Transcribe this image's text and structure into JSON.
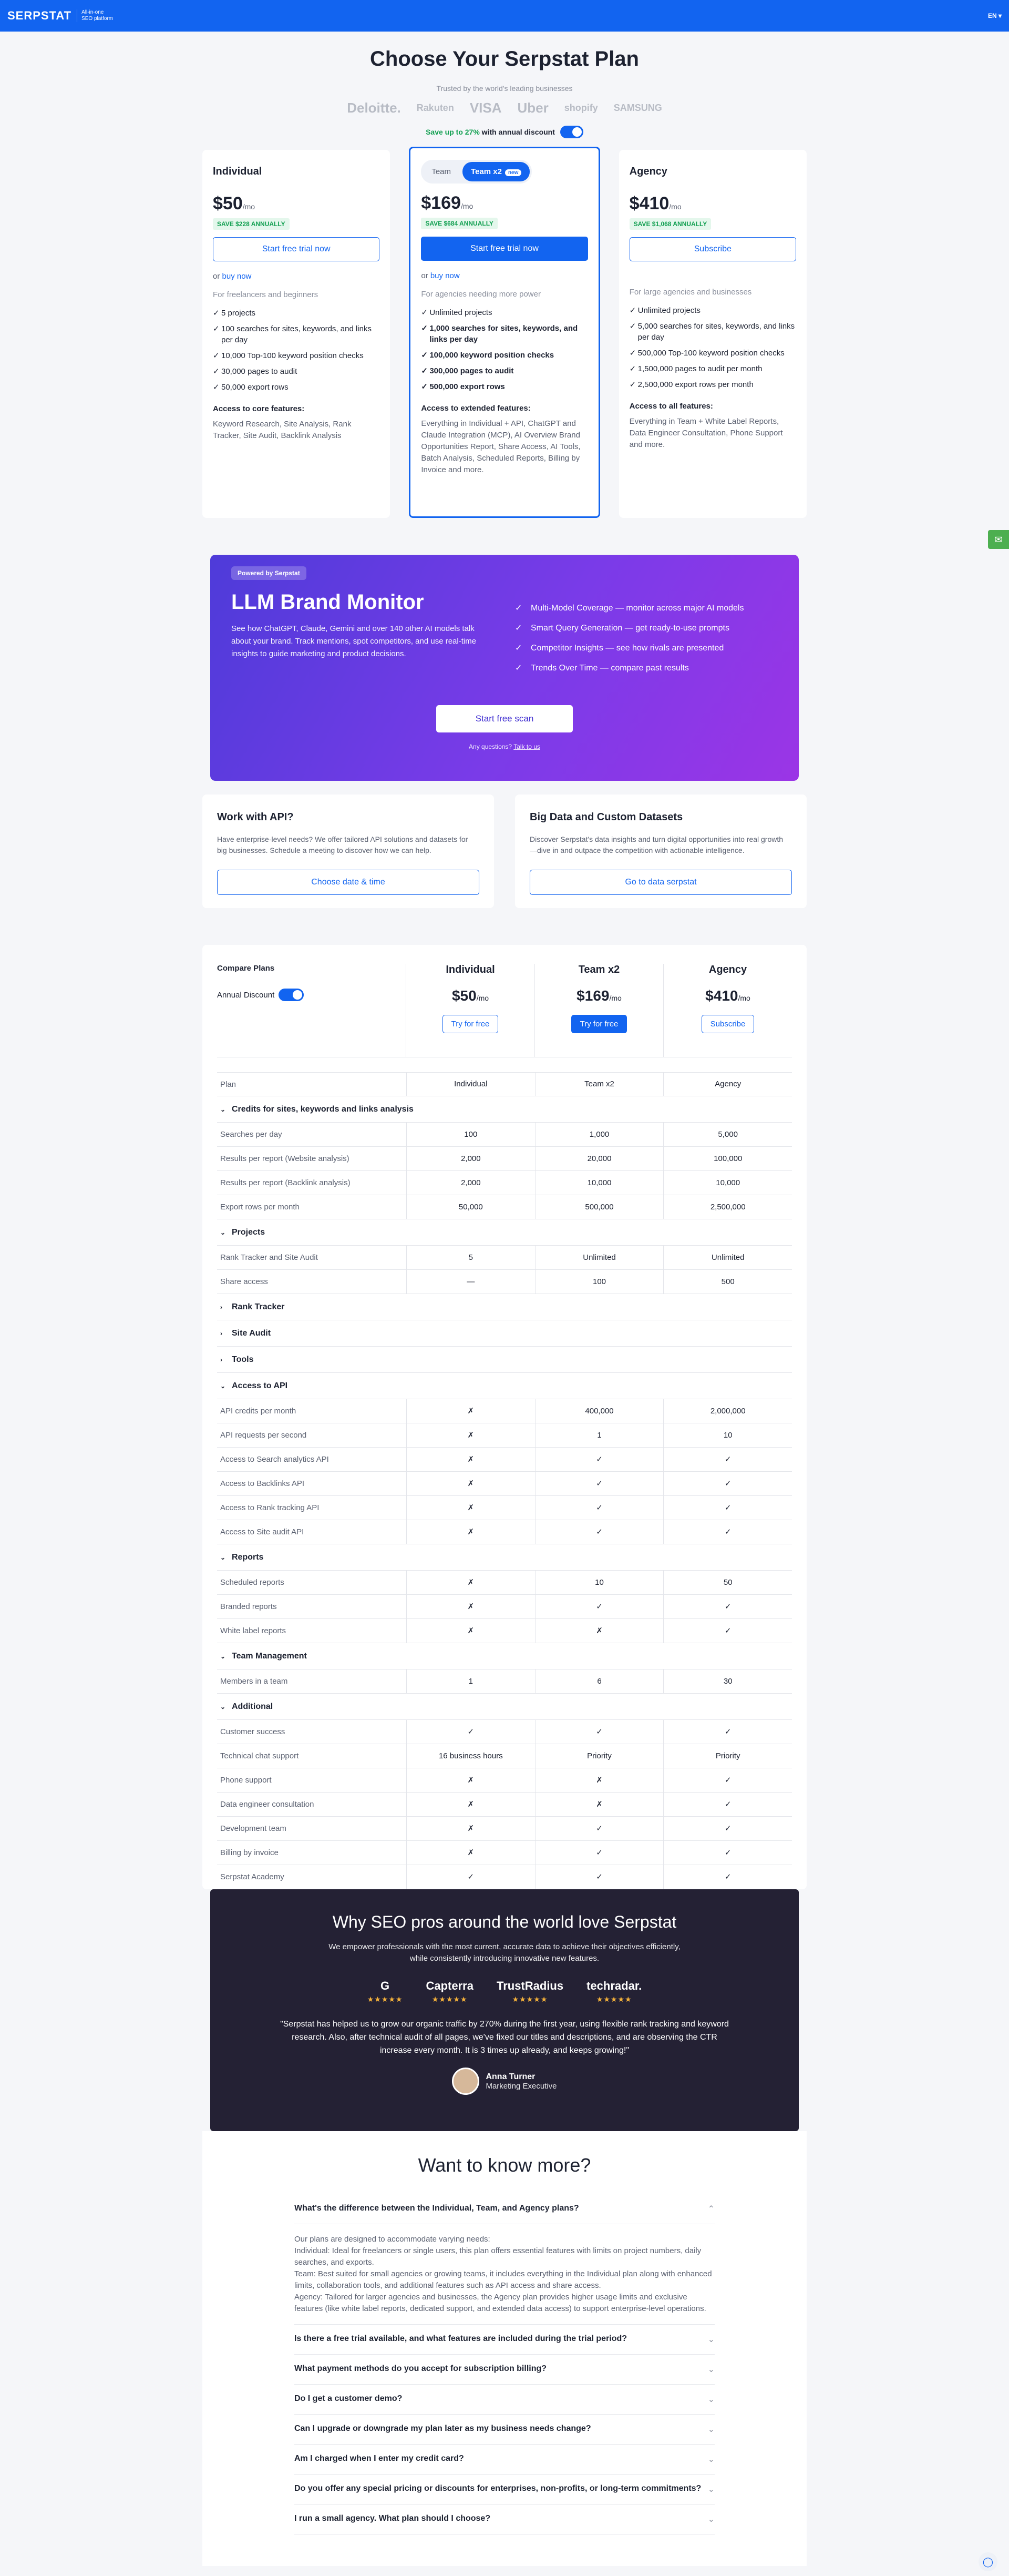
{
  "header": {
    "logo": "SERPSTAT",
    "tagline1": "All-in-one",
    "tagline2": "SEO platform",
    "lang": "EN ▾"
  },
  "hero": {
    "title": "Choose Your Serpstat Plan",
    "trusted": "Trusted by the world's leading businesses",
    "brands": [
      "Deloitte.",
      "Rakuten",
      "VISA",
      "Uber",
      "shopify",
      "SAMSUNG"
    ],
    "discount_prefix": "Save up to 27%",
    "discount_suffix": "with annual discount"
  },
  "plans": [
    {
      "name": "Individual",
      "price": "$50",
      "per": "/mo",
      "save": "SAVE $228 ANNUALLY",
      "cta": "Start free trial now",
      "or": "or",
      "buy": "buy now",
      "for": "For freelancers and beginners",
      "features": [
        "5 projects",
        "100 searches for sites, keywords, and links per day",
        "10,000 Top-100 keyword position checks",
        "30,000 pages to audit",
        "50,000 export rows"
      ],
      "access_title": "Access to core features:",
      "access": "Keyword Research, Site Analysis, Rank Tracker, Site Audit, Backlink Analysis"
    },
    {
      "tab1": "Team",
      "tab2": "Team x2",
      "new": "new",
      "price": "$169",
      "per": "/mo",
      "save": "SAVE $684 ANNUALLY",
      "cta": "Start free trial now",
      "or": "or",
      "buy": "buy now",
      "for": "For agencies needing more power",
      "features": [
        "Unlimited projects",
        "1,000 searches for sites, keywords, and links per day",
        "100,000 keyword position checks",
        "300,000 pages to audit",
        "500,000 export rows"
      ],
      "access_title": "Access to extended features:",
      "access": "Everything in Individual + API, ChatGPT and Claude Integration (MCP), AI Overview Brand Opportunities Report, Share Access, AI Tools, Batch Analysis, Scheduled Reports, Billing by Invoice and more."
    },
    {
      "name": "Agency",
      "price": "$410",
      "per": "/mo",
      "save": "SAVE $1,068 ANNUALLY",
      "cta": "Subscribe",
      "for": "For large agencies and businesses",
      "features": [
        "Unlimited projects",
        "5,000 searches for sites, keywords, and links per day",
        "500,000 Top-100 keyword position checks",
        "1,500,000 pages to audit per month",
        "2,500,000 export rows per month"
      ],
      "access_title": "Access to all features:",
      "access": "Everything in Team + White Label Reports, Data Engineer Consultation, Phone Support and more."
    }
  ],
  "llm": {
    "badge": "Powered by Serpstat",
    "title": "LLM Brand Monitor",
    "desc": "See how ChatGPT, Claude, Gemini and over 140 other AI models talk about your brand. Track mentions, spot competitors, and use real-time insights to guide marketing and product decisions.",
    "bullets": [
      "Multi-Model Coverage — monitor across major AI models",
      "Smart Query Generation — get ready-to-use prompts",
      "Competitor Insights — see how rivals are presented",
      "Trends Over Time — compare past results"
    ],
    "cta": "Start free scan",
    "question": "Any questions?",
    "talk": "Talk to us"
  },
  "api": {
    "title": "Work with API?",
    "desc": "Have enterprise-level needs? We offer tailored API solutions and datasets for big businesses. Schedule a meeting to discover how we can help.",
    "cta": "Choose date & time"
  },
  "bigdata": {
    "title": "Big Data and Custom Datasets",
    "desc": "Discover Serpstat's data insights and turn digital opportunities into real growth —dive in and outpace the competition with actionable intelligence.",
    "cta": "Go to data serpstat"
  },
  "compare": {
    "title": "Compare Plans",
    "annual": "Annual Discount",
    "cols": [
      {
        "name": "Individual",
        "price": "$50",
        "per": "/mo",
        "cta": "Try for free"
      },
      {
        "name": "Team x2",
        "price": "$169",
        "per": "/mo",
        "cta": "Try for free"
      },
      {
        "name": "Agency",
        "price": "$410",
        "per": "/mo",
        "cta": "Subscribe"
      }
    ],
    "plan_row": [
      "Plan",
      "Individual",
      "Team x2",
      "Agency"
    ],
    "sections": [
      {
        "title": "Credits for sites, keywords and links analysis",
        "open": true,
        "rows": [
          [
            "Searches per day",
            "100",
            "1,000",
            "5,000"
          ],
          [
            "Results per report (Website analysis)",
            "2,000",
            "20,000",
            "100,000"
          ],
          [
            "Results per report (Backlink analysis)",
            "2,000",
            "10,000",
            "10,000"
          ],
          [
            "Export rows per month",
            "50,000",
            "500,000",
            "2,500,000"
          ]
        ]
      },
      {
        "title": "Projects",
        "open": true,
        "rows": [
          [
            "Rank Tracker and Site Audit",
            "5",
            "Unlimited",
            "Unlimited"
          ],
          [
            "Share access",
            "—",
            "100",
            "500"
          ]
        ]
      },
      {
        "title": "Rank Tracker",
        "open": false,
        "rows": []
      },
      {
        "title": "Site Audit",
        "open": false,
        "rows": []
      },
      {
        "title": "Tools",
        "open": false,
        "rows": []
      },
      {
        "title": "Access to API",
        "open": true,
        "rows": [
          [
            "API credits per month",
            "✗",
            "400,000",
            "2,000,000"
          ],
          [
            "API requests per second",
            "✗",
            "1",
            "10"
          ],
          [
            "Access to Search analytics API",
            "✗",
            "✓",
            "✓"
          ],
          [
            "Access to Backlinks API",
            "✗",
            "✓",
            "✓"
          ],
          [
            "Access to Rank tracking API",
            "✗",
            "✓",
            "✓"
          ],
          [
            "Access to Site audit API",
            "✗",
            "✓",
            "✓"
          ]
        ]
      },
      {
        "title": "Reports",
        "open": true,
        "rows": [
          [
            "Scheduled reports",
            "✗",
            "10",
            "50"
          ],
          [
            "Branded reports",
            "✗",
            "✓",
            "✓"
          ],
          [
            "White label reports",
            "✗",
            "✗",
            "✓"
          ]
        ]
      },
      {
        "title": "Team Management",
        "open": true,
        "rows": [
          [
            "Members in a team",
            "1",
            "6",
            "30"
          ]
        ]
      },
      {
        "title": "Additional",
        "open": true,
        "rows": [
          [
            "Customer success",
            "✓",
            "✓",
            "✓"
          ],
          [
            "Technical chat support",
            "16 business hours",
            "Priority",
            "Priority"
          ],
          [
            "Phone support",
            "✗",
            "✗",
            "✓"
          ],
          [
            "Data engineer consultation",
            "✗",
            "✗",
            "✓"
          ],
          [
            "Development team",
            "✗",
            "✓",
            "✓"
          ],
          [
            "Billing by invoice",
            "✗",
            "✓",
            "✓"
          ],
          [
            "Serpstat Academy",
            "✓",
            "✓",
            "✓"
          ]
        ]
      }
    ]
  },
  "why": {
    "title": "Why SEO pros around the world love Serpstat",
    "desc": "We empower professionals with the most current, accurate data to achieve their objectives efficiently, while consistently introducing innovative new features.",
    "reviews": [
      "G",
      "Capterra",
      "TrustRadius",
      "techradar."
    ],
    "stars": "★★★★★",
    "quote": "\"Serpstat has helped us to grow our organic traffic by 270% during the first year, using flexible rank tracking and keyword research. Also, after technical audit of all pages, we've fixed our titles and descriptions, and are observing the CTR increase every month. It is 3 times up already, and keeps growing!\"",
    "author": "Anna Turner",
    "role": "Marketing Executive"
  },
  "faq": {
    "title": "Want to know more?",
    "items": [
      "What's the difference between the Individual, Team, and Agency plans?",
      "Is there a free trial available, and what features are included during the trial period?",
      "What payment methods do you accept for subscription billing?",
      "Do I get a customer demo?",
      "Can I upgrade or downgrade my plan later as my business needs change?",
      "Am I charged when I enter my credit card?",
      "Do you offer any special pricing or discounts for enterprises, non-profits, or long-term commitments?",
      "I run a small agency. What plan should I choose?"
    ],
    "answer": [
      "Our plans are designed to accommodate varying needs:",
      "Individual: Ideal for freelancers or single users, this plan offers essential features with limits on project numbers, daily searches, and exports.",
      "Team: Best suited for small agencies or growing teams, it includes everything in the Individual plan along with enhanced limits, collaboration tools, and additional features such as API access and share access.",
      "Agency: Tailored for larger agencies and businesses, the Agency plan provides higher usage limits and exclusive features (like white label reports, dedicated support, and extended data access) to support enterprise-level operations."
    ]
  }
}
